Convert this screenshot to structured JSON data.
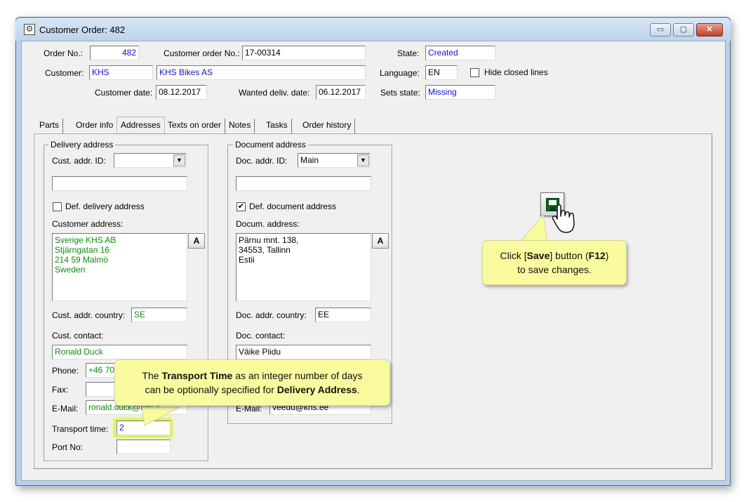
{
  "window": {
    "title": "Customer Order: 482",
    "minimize": "▭",
    "maximize": "▢",
    "close": "✕"
  },
  "header": {
    "order_no_label": "Order No.:",
    "order_no": "482",
    "customer_order_no_label": "Customer order No.:",
    "customer_order_no": "17-00314",
    "state_label": "State:",
    "state": "Created",
    "customer_label": "Customer:",
    "customer_code": "KHS",
    "customer_name": "KHS Bikes AS",
    "language_label": "Language:",
    "language": "EN",
    "hide_closed_label": "Hide closed lines",
    "hide_closed_checked": false,
    "customer_date_label": "Customer date:",
    "customer_date": "08.12.2017",
    "wanted_delivery_label": "Wanted deliv. date:",
    "wanted_delivery": "06.12.2017",
    "sets_state_label": "Sets state:",
    "sets_state": "Missing"
  },
  "tabs": [
    {
      "label": "Parts",
      "selected": false
    },
    {
      "label": "Order info",
      "selected": false
    },
    {
      "label": "Addresses",
      "selected": true
    },
    {
      "label": "Texts on order",
      "selected": false
    },
    {
      "label": "Notes",
      "selected": false
    },
    {
      "label": "Tasks",
      "selected": false
    },
    {
      "label": "Order history",
      "selected": false
    }
  ],
  "delivery": {
    "group_title": "Delivery address",
    "addr_id_label": "Cust. addr. ID:",
    "addr_id": "",
    "extra_field": "",
    "def_label": "Def. delivery address",
    "def_checked": false,
    "address_label": "Customer address:",
    "address": "Sverige KHS AB\nStjärngatan 16\n214 59 Malmö\nSweden",
    "a_button": "A",
    "country_label": "Cust. addr. country:",
    "country": "SE",
    "contact_label": "Cust. contact:",
    "contact": "Ronald Duck",
    "phone_label": "Phone:",
    "phone": "+46 70",
    "fax_label": "Fax:",
    "fax": "",
    "email_label": "E-Mail:",
    "email": "ronald.duck@khs.s",
    "transport_label": "Transport time:",
    "transport": "2",
    "port_label": "Port No:",
    "port": ""
  },
  "document": {
    "group_title": "Document address",
    "addr_id_label": "Doc. addr. ID:",
    "addr_id": "Main",
    "extra_field": "",
    "def_label": "Def. document address",
    "def_checked": true,
    "address_label": "Docum. address:",
    "address": "Pärnu mnt. 138,\n34553, Tallinn\nEstii",
    "a_button": "A",
    "country_label": "Doc. addr. country:",
    "country": "EE",
    "contact_label": "Doc. contact:",
    "contact": "Väike Piidu",
    "email_label": "E-Mail:",
    "email": "veedu@khs.ee"
  },
  "callouts": {
    "save_pre": "Click [",
    "save_bold": "Save",
    "save_mid": "] button (",
    "save_key": "F12",
    "save_post": ")",
    "save_line2": "to save changes.",
    "transport_pre": "The ",
    "transport_bold": "Transport Time",
    "transport_mid": " as an integer number of days",
    "transport_line2_pre": "can be optionally specified for ",
    "transport_bold2": "Delivery Address",
    "transport_line2_post": "."
  },
  "icons": {
    "window_icon": "gear-icon",
    "save": "floppy-disk-icon",
    "pointer": "hand-pointer-icon",
    "dropdown": "chevron-down-icon"
  },
  "colors": {
    "value_blue": "#1111cc",
    "value_green": "#118811",
    "callout_bg": "#fafa9f",
    "highlight": "#e5f24a",
    "window_frame": "#b9d1ea"
  }
}
